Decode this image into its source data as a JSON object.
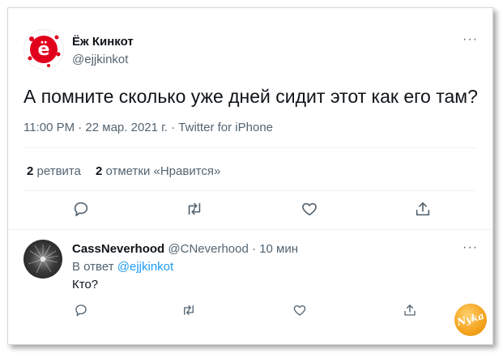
{
  "tweet": {
    "author_name": "Ёж Кинкот",
    "author_handle": "@ejjkinkot",
    "more_label": "···",
    "text": "А помните сколько уже дней сидит этот как его там?",
    "meta": "11:00 PM · 22 мар. 2021 г. · Twitter for iPhone",
    "retweets_count": "2",
    "retweets_label": "ретвита",
    "likes_count": "2",
    "likes_label": "отметки «Нравится»",
    "avatar_letter": "ё"
  },
  "reply": {
    "author_name": "CassNeverhood",
    "author_handle": "@CNeverhood",
    "separator": "·",
    "time": "10 мин",
    "reply_to_prefix": "В ответ",
    "reply_to_handle": "@ejjkinkot",
    "text": "Кто?",
    "more_label": "···"
  },
  "icons": [
    "reply-icon",
    "retweet-icon",
    "like-icon",
    "share-icon",
    "more-icon"
  ],
  "colors": {
    "text_primary": "#0f1419",
    "text_secondary": "#536471",
    "link": "#1d9bf0",
    "avatar_red": "#e0001b",
    "watermark_orange": "#f5a623"
  },
  "watermark": {
    "text": "Nyka"
  }
}
